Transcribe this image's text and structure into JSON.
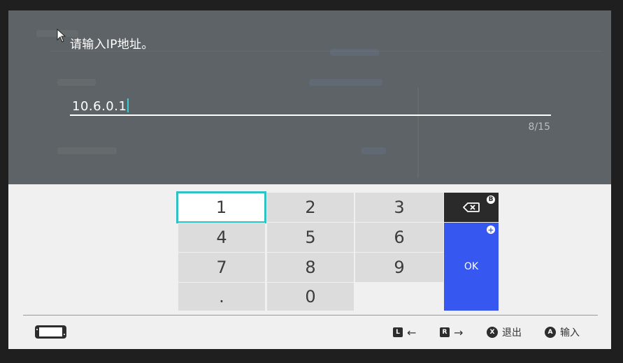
{
  "dialog": {
    "prompt": "请输入IP地址。",
    "value": "10.6.0.1",
    "char_count": "8/15"
  },
  "keypad": {
    "keys": [
      "1",
      "2",
      "3",
      "4",
      "5",
      "6",
      "7",
      "8",
      "9",
      ".",
      "0"
    ],
    "selected_key": "1",
    "backspace_icon": "backspace-icon",
    "backspace_badge": "B",
    "ok_label": "OK",
    "ok_badge": "+"
  },
  "footer": {
    "console_icon": "switch-console-icon",
    "hints": [
      {
        "button": "L",
        "label": "←"
      },
      {
        "button": "R",
        "label": "→"
      },
      {
        "button": "X",
        "label": "退出"
      },
      {
        "button": "A",
        "label": "输入"
      }
    ]
  },
  "colors": {
    "overlay": "#5d6366",
    "selected_border": "#2fc1c4",
    "ok_blue": "#3657f0",
    "key_bg": "#dcdcdc"
  }
}
